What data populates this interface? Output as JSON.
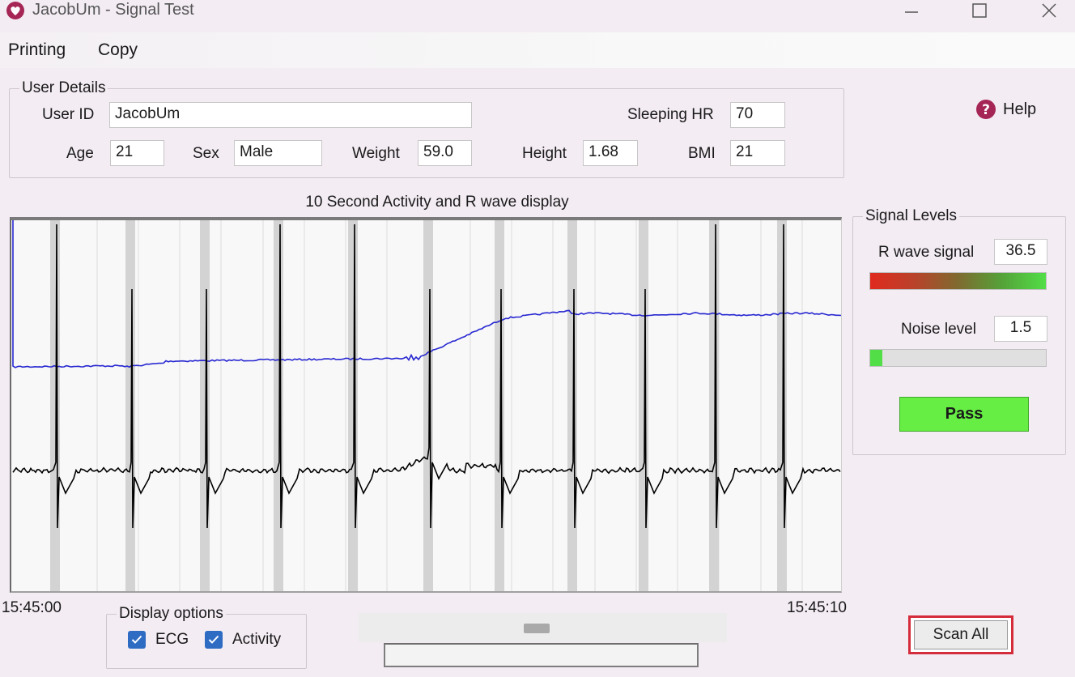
{
  "window": {
    "title": "JacobUm - Signal Test",
    "icon": "heart-app-icon",
    "controls": [
      "minimize-icon",
      "maximize-icon",
      "close-icon"
    ]
  },
  "menu": {
    "items": [
      "Printing",
      "Copy"
    ]
  },
  "user_details": {
    "legend": "User Details",
    "user_id_label": "User ID",
    "user_id": "JacobUm",
    "sleeping_hr_label": "Sleeping HR",
    "sleeping_hr": "70",
    "age_label": "Age",
    "age": "21",
    "sex_label": "Sex",
    "sex": "Male",
    "weight_label": "Weight",
    "weight": "59.0",
    "height_label": "Height",
    "height": "1.68",
    "bmi_label": "BMI",
    "bmi": "21"
  },
  "help": {
    "label": "Help",
    "icon": "question-mark-icon"
  },
  "chart": {
    "title": "10 Second Activity and R wave display",
    "start_time": "15:45:00",
    "end_time": "15:45:10"
  },
  "signal_levels": {
    "legend": "Signal Levels",
    "r_wave_label": "R wave signal",
    "r_wave_value": "36.5",
    "r_wave_level": 1.0,
    "noise_label": "Noise level",
    "noise_value": "1.5",
    "noise_level": 0.07,
    "pass_label": "Pass"
  },
  "display_options": {
    "legend": "Display options",
    "ecg_label": "ECG",
    "ecg_checked": true,
    "activity_label": "Activity",
    "activity_checked": true
  },
  "scan_all_label": "Scan All",
  "colors": {
    "activity_trace": "#2727d2",
    "ecg_trace": "#000000",
    "pass_green": "#66ee44",
    "highlight_red": "#d42c3a",
    "checkbox_blue": "#2e6cc4"
  }
}
